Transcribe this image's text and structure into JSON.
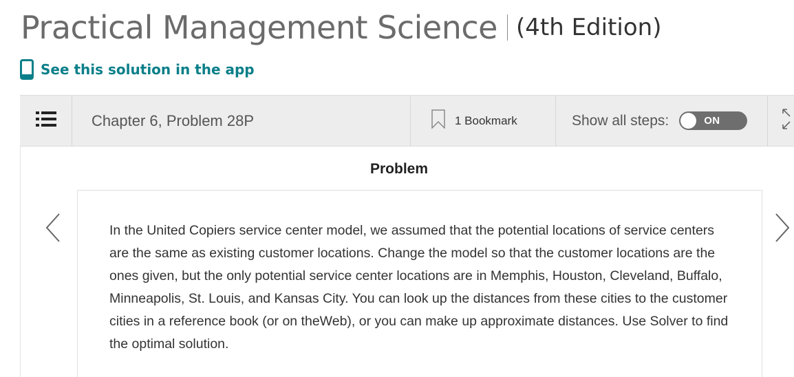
{
  "header": {
    "book_title": "Practical Management Science",
    "edition": "(4th Edition)"
  },
  "app_link": {
    "label": "See this solution in the app",
    "icon": "phone-icon",
    "color": "#0a7f89"
  },
  "toolbar": {
    "menu_icon": "list-icon",
    "chapter_problem": "Chapter 6, Problem 28P",
    "bookmark_icon": "bookmark-icon",
    "bookmark_label": "1 Bookmark",
    "show_steps_label": "Show all steps:",
    "show_steps_toggle": "ON",
    "expand_icon": "expand-icon"
  },
  "problem": {
    "heading": "Problem",
    "text": "In the United Copiers service center model, we assumed that the potential locations of service centers are the same as existing customer locations. Change the model so that the customer locations are the ones given, but the only potential service center locations are in Memphis, Houston, Cleveland, Buffalo, Minneapolis, St. Louis, and Kansas City. You can look up the distances from these cities to the customer cities in a reference book (or on theWeb), or you can make up approximate distances. Use Solver to find the optimal solution."
  },
  "navigation": {
    "prev_icon": "chevron-left-icon",
    "next_icon": "chevron-right-icon"
  }
}
